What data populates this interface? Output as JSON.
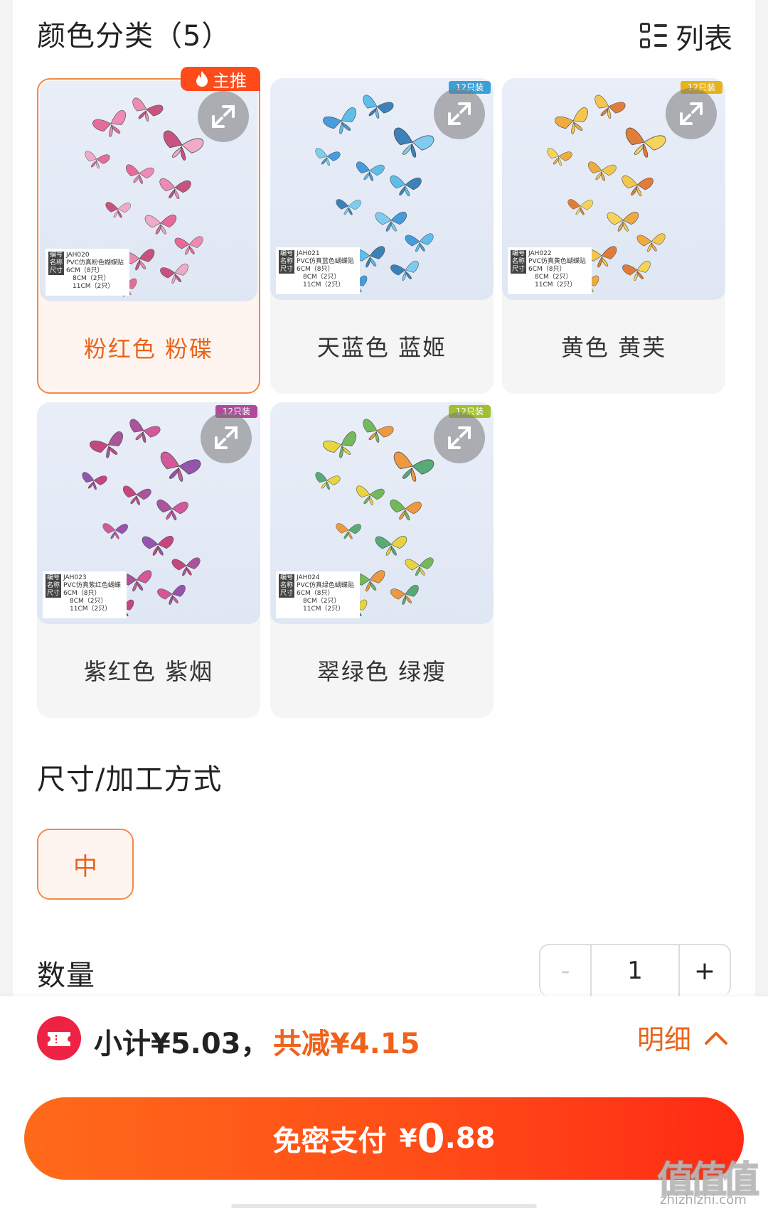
{
  "color_section": {
    "title": "颜色分类（5）",
    "view_toggle_label": "列表",
    "main_push_badge": "主推",
    "options": [
      {
        "label": "粉红色 粉碟",
        "selected": true,
        "tag": "",
        "tag_color": "#ff4a1a",
        "code": "JAH020",
        "name": "PVC仿真粉色蝴蝶贴",
        "palette": [
          "#e8558a",
          "#f07aa8",
          "#c23a6a",
          "#f2a0c0"
        ]
      },
      {
        "label": "天蓝色 蓝姬",
        "selected": false,
        "tag": "12只装",
        "tag_color": "#3aa0d8",
        "code": "JAH021",
        "name": "PVC仿真蓝色蝴蝶贴",
        "palette": [
          "#2a8fd8",
          "#49b6e8",
          "#1f6fb0",
          "#6cc8f0"
        ]
      },
      {
        "label": "黄色 黄芙",
        "selected": false,
        "tag": "12只装",
        "tag_color": "#e8b21a",
        "code": "JAH022",
        "name": "PVC仿真黄色蝴蝶贴",
        "palette": [
          "#f0a020",
          "#f6c030",
          "#e06a18",
          "#f8d040"
        ]
      },
      {
        "label": "紫红色 紫烟",
        "selected": false,
        "tag": "12只装",
        "tag_color": "#b04a9a",
        "code": "JAH023",
        "name": "PVC仿真紫红色蝴蝶",
        "palette": [
          "#c02a6a",
          "#a03a8a",
          "#d0408a",
          "#8a3aa0"
        ]
      },
      {
        "label": "翠绿色 绿瘦",
        "selected": false,
        "tag": "12只装",
        "tag_color": "#a0c030",
        "code": "JAH024",
        "name": "PVC仿真绿色蝴蝶贴",
        "palette": [
          "#e8d020",
          "#60b040",
          "#f08a20",
          "#40a060"
        ]
      }
    ],
    "info_keys": {
      "code": "编号",
      "name": "名称",
      "size": "尺寸"
    },
    "info_sizes": [
      "6CM（8只）",
      "8CM（2只）",
      "11CM（2只）"
    ]
  },
  "size_section": {
    "title": "尺寸/加工方式",
    "options": [
      {
        "label": "中",
        "selected": true
      }
    ]
  },
  "quantity_section": {
    "title": "数量",
    "minus": "-",
    "value": "1",
    "plus": "+"
  },
  "summary": {
    "subtotal": "小计¥5.03，",
    "discount": "共减¥4.15",
    "detail_label": "明细"
  },
  "pay_button": {
    "label": "免密支付",
    "currency": "¥",
    "amount_int": "0",
    "amount_dec": ".88"
  },
  "watermark": {
    "logo": "值值值",
    "url": "zhizhizhi.com"
  },
  "colors": {
    "accent": "#e8641c",
    "pay_gradient_start": "#ff6a1a",
    "pay_gradient_end": "#ff2a14",
    "coupon_red": "#ee2244"
  }
}
